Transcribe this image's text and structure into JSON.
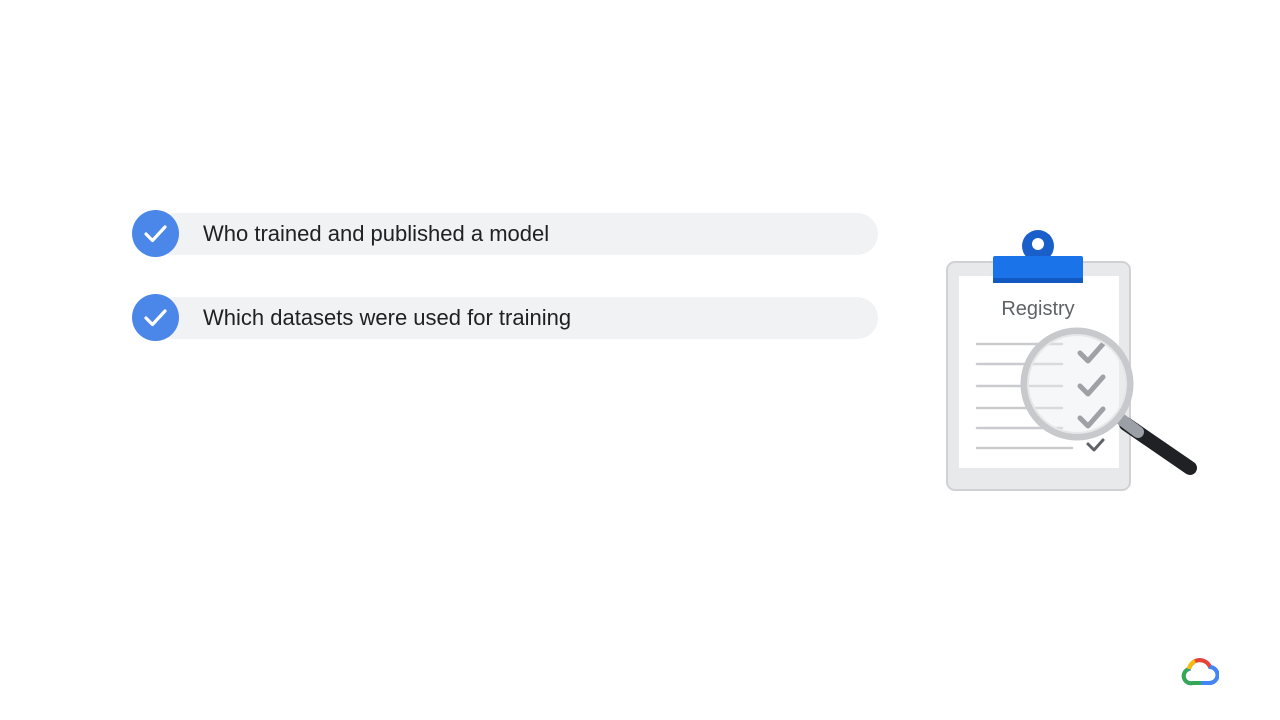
{
  "bullets": [
    {
      "label": "Who trained and published a model",
      "icon": "check-circle-icon"
    },
    {
      "label": "Which datasets were used for training",
      "icon": "check-circle-icon"
    }
  ],
  "illustration": {
    "title": "Registry",
    "icon": "clipboard-magnifier-icon"
  },
  "branding": {
    "icon": "google-cloud-logo-icon"
  },
  "colors": {
    "accent": "#4a87e8",
    "bar": "#f1f2f3",
    "text": "#202124",
    "clip_blue": "#1a73e8"
  }
}
